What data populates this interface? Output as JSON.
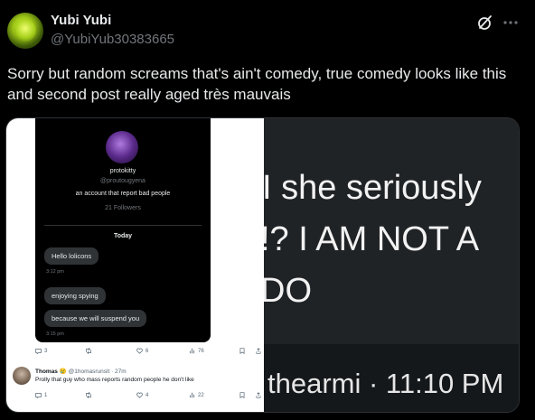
{
  "tweet": {
    "display_name": "Yubi Yubi",
    "handle": "@YubiYub30383665",
    "text": "Sorry but random screams that's ain't comedy, true comedy looks like this and second post really aged très mauvais",
    "icons": {
      "grok": "grok-icon",
      "more": "more-icon"
    }
  },
  "left_image": {
    "profile": {
      "name": "protokitty",
      "handle": "@proutougyena",
      "bio": "an account that report bad people",
      "followers": "21 Followers"
    },
    "day_label": "Today",
    "messages": [
      {
        "text": "Hello lolicons",
        "time": "3:12 pm"
      },
      {
        "text": "enjoying spying",
        "time": ""
      },
      {
        "text": "because we will suspend you",
        "time": "3:15 pm"
      }
    ],
    "post_actions": {
      "replies": "3",
      "likes": "6",
      "views": "76"
    },
    "reply": {
      "name": "Thomas",
      "emoji": "😢",
      "handle": "@1homasrunslt",
      "age": "· 27m",
      "text": "Prolly that guy who mass reports random people he don't like",
      "actions": {
        "replies": "1",
        "likes": "4",
        "views": "22"
      }
    }
  },
  "right_image": {
    "line1": "I she seriously",
    "line2": "!? I AM NOT A",
    "line3": "DO",
    "footer": "thearmi · 11:10 PM"
  },
  "colors": {
    "background": "#000000",
    "text": "#e7e9ea",
    "muted": "#71767b",
    "border": "#2f3336"
  }
}
